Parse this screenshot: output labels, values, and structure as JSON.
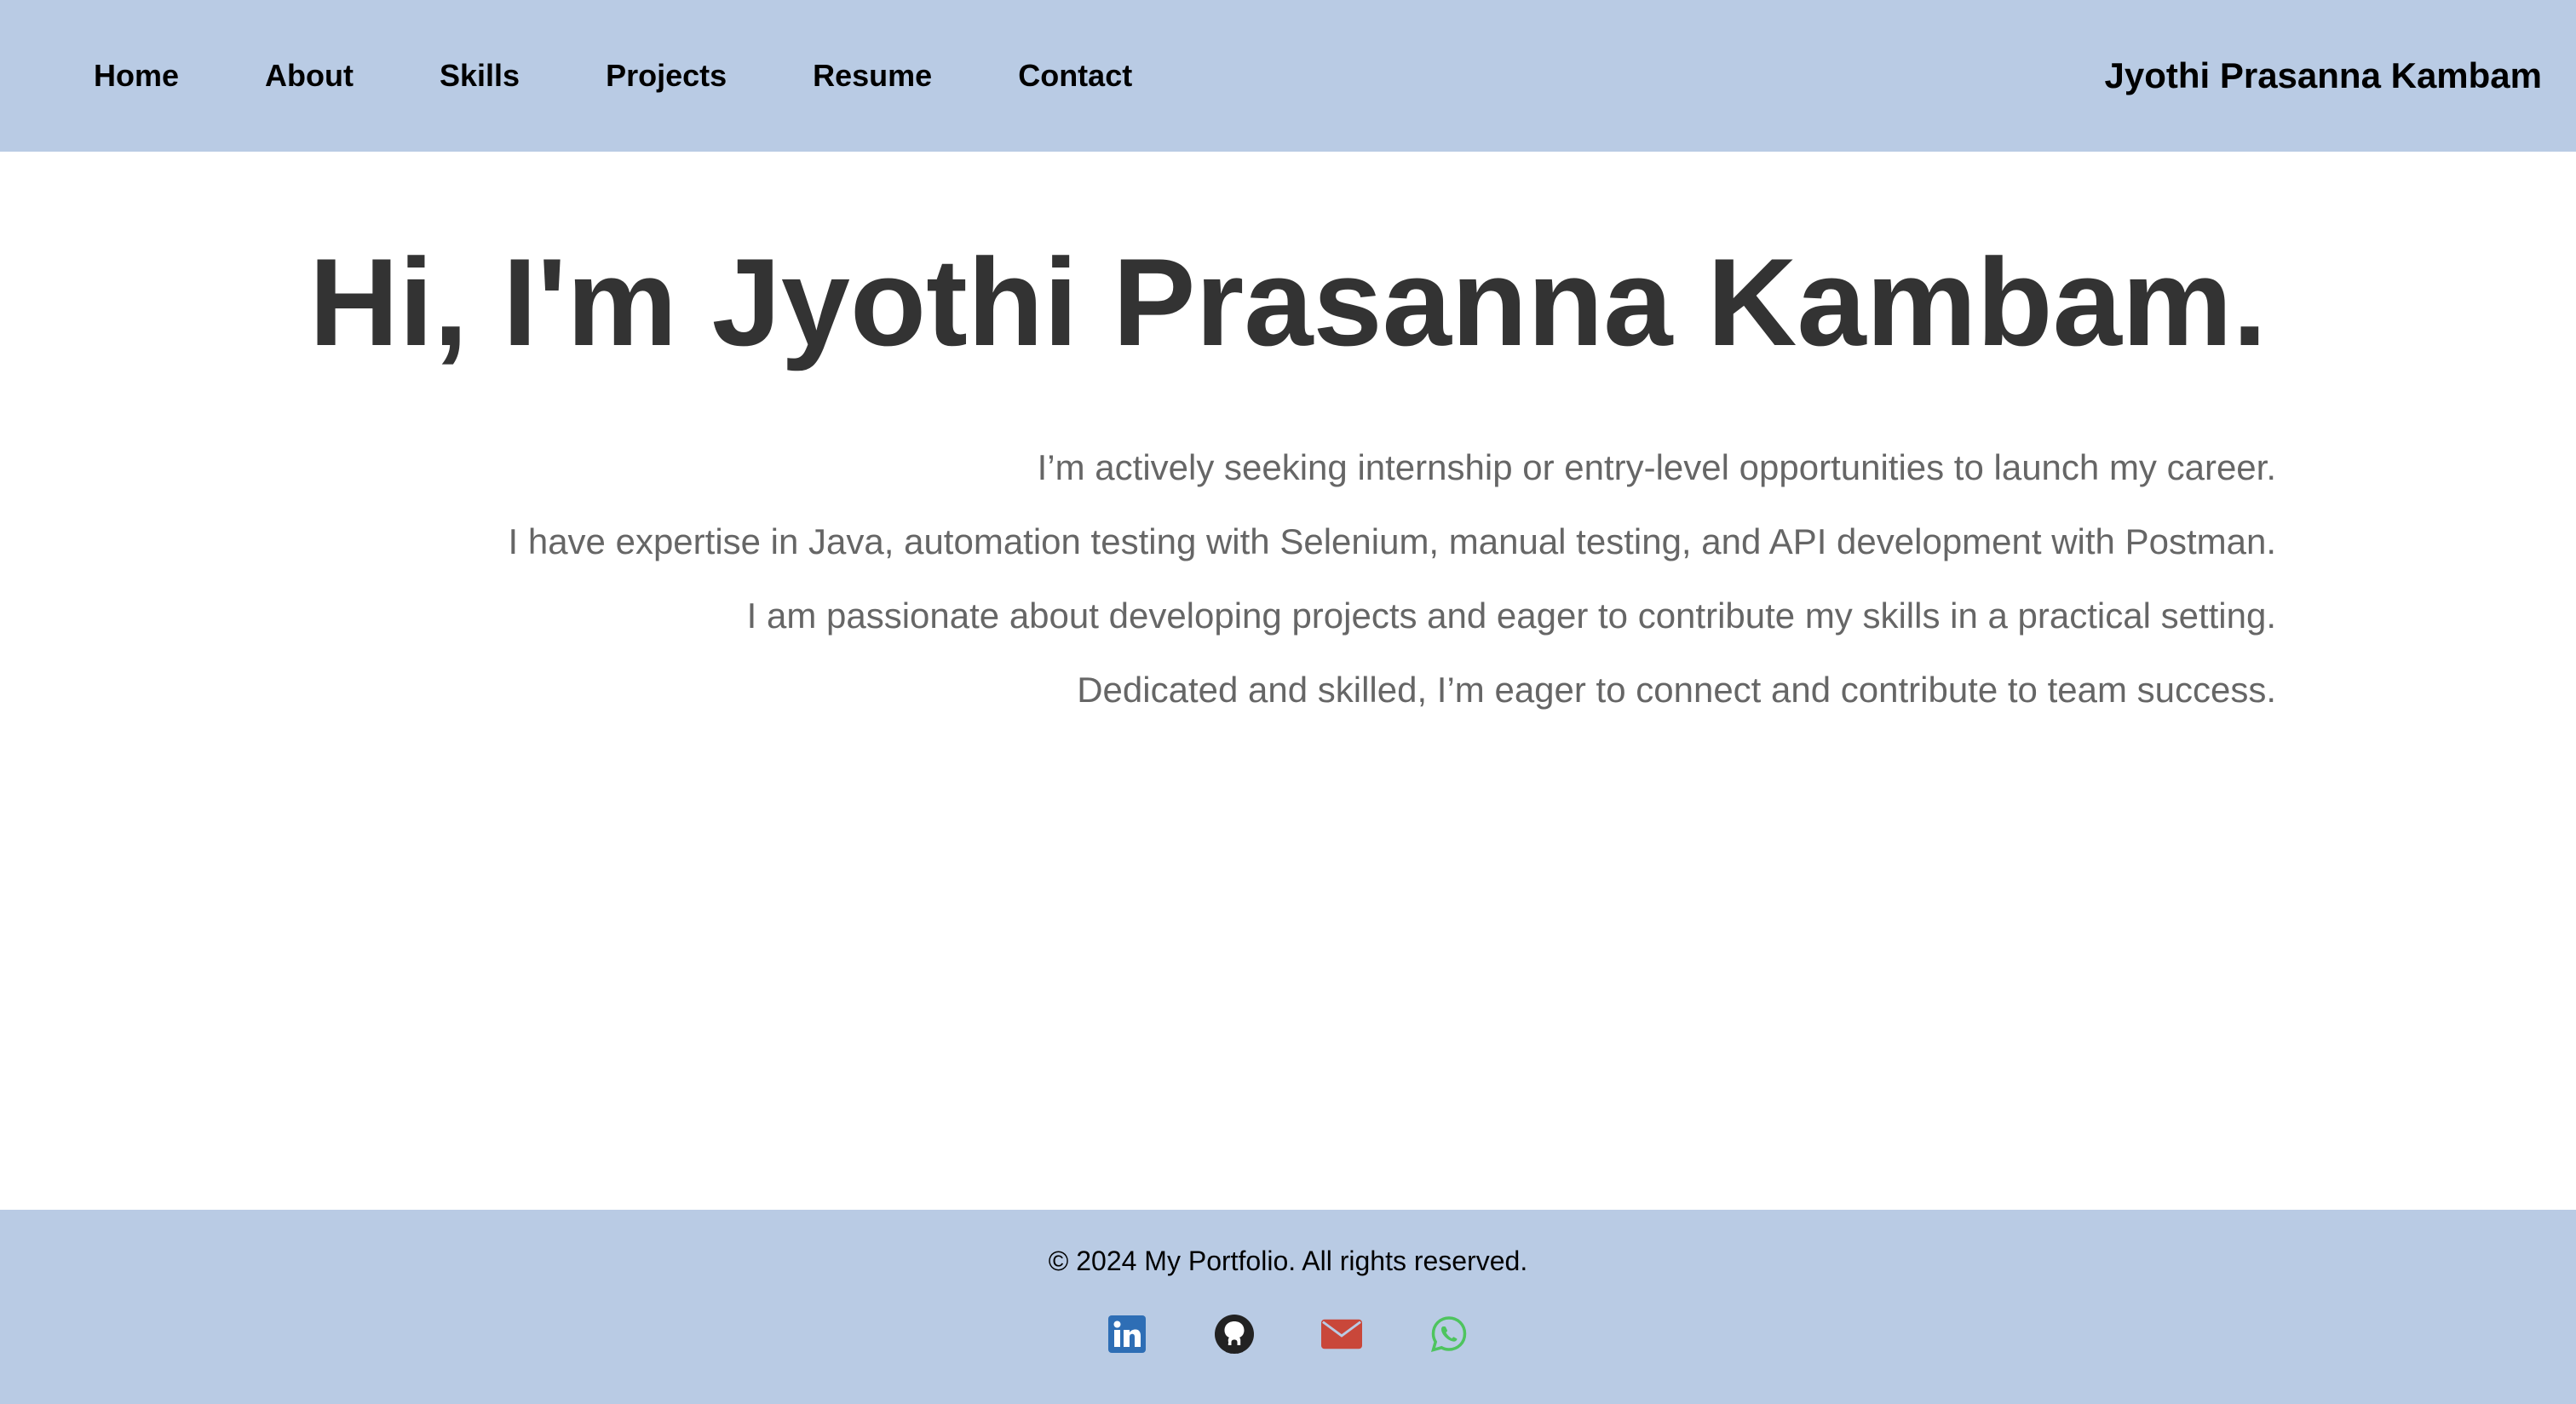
{
  "nav": {
    "items": [
      {
        "label": "Home"
      },
      {
        "label": "About"
      },
      {
        "label": "Skills"
      },
      {
        "label": "Projects"
      },
      {
        "label": "Resume"
      },
      {
        "label": "Contact"
      }
    ],
    "brand": "Jyothi Prasanna Kambam"
  },
  "hero": {
    "title": "Hi, I'm Jyothi Prasanna Kambam.",
    "lines": [
      "I’m actively seeking internship or entry-level opportunities to launch my career.",
      "I have expertise in Java, automation testing with Selenium, manual testing, and API development with Postman.",
      "I am passionate about developing projects and eager to contribute my skills in a practical setting.",
      "Dedicated and skilled, I’m eager to connect and contribute to team success."
    ]
  },
  "footer": {
    "copyright": "© 2024 My Portfolio. All rights reserved.",
    "socials": [
      {
        "icon": "linkedin-icon",
        "color": "#2e6eb5"
      },
      {
        "icon": "github-icon",
        "color": "#222222"
      },
      {
        "icon": "envelope-icon",
        "color": "#c9473a"
      },
      {
        "icon": "whatsapp-icon",
        "color": "#4ec45e"
      }
    ]
  },
  "colors": {
    "bar_background": "#b9cbe4",
    "heading_text": "#333333",
    "body_text": "#666666"
  }
}
